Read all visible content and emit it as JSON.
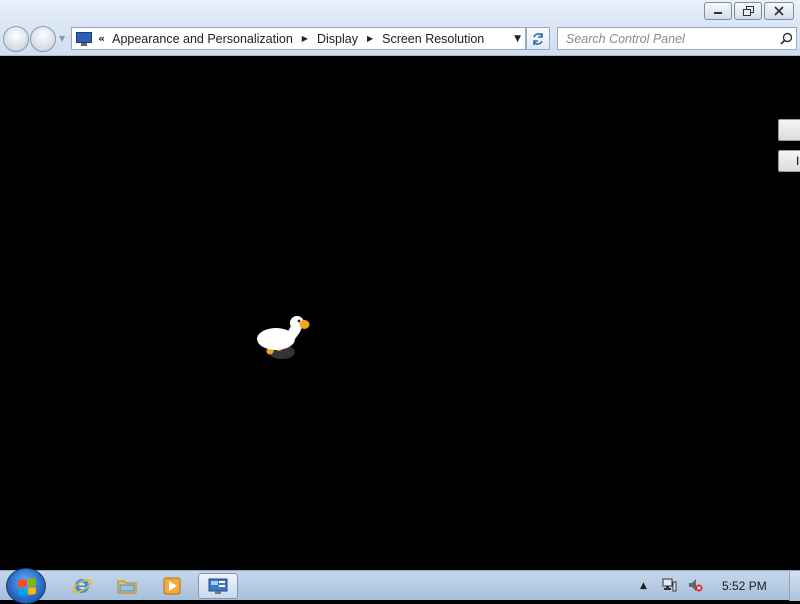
{
  "window": {
    "caption": {
      "minimize_icon": "minimize-icon",
      "restore_icon": "restore-icon",
      "close_icon": "close-icon"
    }
  },
  "navigation": {
    "back_icon": "back-arrow-icon",
    "forward_icon": "forward-arrow-icon",
    "overflow": "«",
    "breadcrumbs": [
      "Appearance and Personalization",
      "Display",
      "Screen Resolution"
    ]
  },
  "search": {
    "placeholder": "Search Control Panel"
  },
  "content": {
    "edge_buttons": [
      "",
      "I"
    ]
  },
  "taskbar": {
    "pinned": [
      {
        "name": "internet-explorer-icon"
      },
      {
        "name": "windows-explorer-icon"
      },
      {
        "name": "media-player-icon"
      },
      {
        "name": "control-panel-icon",
        "active": true
      }
    ],
    "tray": {
      "clock": "5:52 PM"
    }
  },
  "colors": {
    "accent": "#2f6bb3",
    "goose_beak": "#f5a21c",
    "background": "#000000"
  }
}
